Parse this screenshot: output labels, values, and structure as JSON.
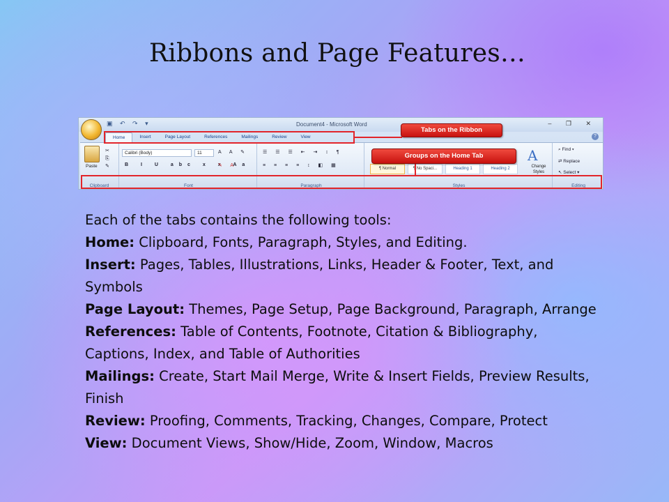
{
  "slide": {
    "title": "Ribbons and Page Features…"
  },
  "ribbon": {
    "window_title": "Document4 - Microsoft Word",
    "tabs": [
      {
        "label": "Home",
        "active": true
      },
      {
        "label": "Insert"
      },
      {
        "label": "Page Layout"
      },
      {
        "label": "References"
      },
      {
        "label": "Mailings"
      },
      {
        "label": "Review"
      },
      {
        "label": "View"
      }
    ],
    "clipboard": {
      "paste_label": "Paste",
      "group_label": "Clipboard"
    },
    "font": {
      "font_name": "Calibri (Body)",
      "font_size": "11",
      "group_label": "Font"
    },
    "paragraph": {
      "group_label": "Paragraph"
    },
    "styles": {
      "items": [
        "¶ Normal",
        "¶ No Spaci...",
        "Heading 1",
        "Heading 2"
      ],
      "change_styles_label": "Change Styles",
      "group_label": "Styles"
    },
    "editing": {
      "find_label": "Find",
      "replace_label": "Replace",
      "select_label": "Select",
      "group_label": "Editing"
    },
    "callouts": {
      "tabs": "Tabs on the Ribbon",
      "groups": "Groups on the Home Tab"
    },
    "colors": {
      "highlight": "#e2242a",
      "ribbon_bg": "#dbe7f6"
    }
  },
  "content": {
    "intro": "Each of the tabs contains the following tools:",
    "items": [
      {
        "term": "Home:",
        "desc": " Clipboard, Fonts, Paragraph, Styles, and Editing."
      },
      {
        "term": "Insert:",
        "desc": " Pages, Tables, Illustrations, Links, Header & Footer, Text, and Symbols"
      },
      {
        "term": "Page Layout:",
        "desc": " Themes, Page Setup, Page Background, Paragraph, Arrange"
      },
      {
        "term": "References:",
        "desc": " Table of Contents, Footnote, Citation & Bibliography, Captions, Index, and Table of Authorities"
      },
      {
        "term": "Mailings:",
        "desc": " Create, Start Mail Merge, Write & Insert Fields, Preview Results, Finish"
      },
      {
        "term": "Review:",
        "desc": " Proofing, Comments, Tracking, Changes, Compare, Protect"
      },
      {
        "term": "View:",
        "desc": " Document Views, Show/Hide, Zoom, Window, Macros"
      }
    ]
  }
}
